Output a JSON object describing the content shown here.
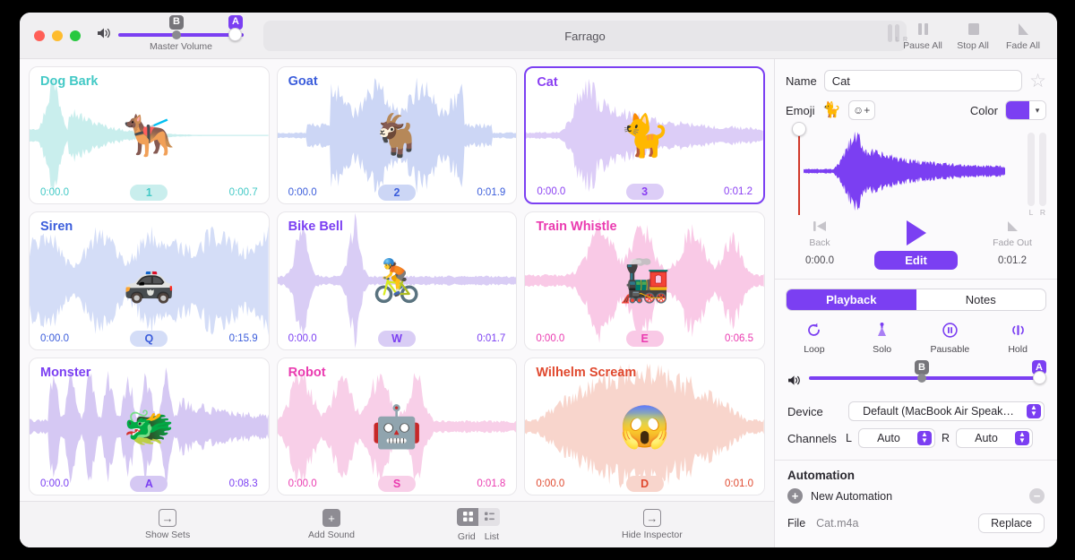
{
  "window": {
    "title": "Farrago",
    "traffic_lights": [
      "close",
      "minimize",
      "zoom"
    ]
  },
  "master_volume": {
    "label": "Master Volume",
    "badge_b": "B",
    "badge_a": "A",
    "icon": "speaker-icon"
  },
  "toolbar": {
    "buttons": [
      {
        "label": "Pause All",
        "icon": "pause-icon"
      },
      {
        "label": "Stop All",
        "icon": "stop-icon"
      },
      {
        "label": "Fade All",
        "icon": "fade-icon"
      }
    ]
  },
  "meters": {
    "left": "L",
    "right": "R"
  },
  "tiles": [
    {
      "name": "Dog Bark",
      "emoji": "🐕‍🦺",
      "hotkey": "1",
      "start": "0:00.0",
      "end": "0:00.7",
      "color": "#43c9c6",
      "wave_fill": "#c9eeed",
      "selected": false,
      "shape": "spike-left"
    },
    {
      "name": "Goat",
      "emoji": "🐐",
      "hotkey": "2",
      "start": "0:00.0",
      "end": "0:01.9",
      "color": "#3b5ddb",
      "wave_fill": "#ccd6f5",
      "selected": false,
      "shape": "dense-center"
    },
    {
      "name": "Cat",
      "emoji": "🐈",
      "hotkey": "3",
      "start": "0:00.0",
      "end": "0:01.2",
      "color": "#8a3ff2",
      "wave_fill": "#dccdf7",
      "selected": true,
      "shape": "peak-left"
    },
    {
      "name": "Siren",
      "emoji": "🚓",
      "hotkey": "Q",
      "start": "0:00.0",
      "end": "0:15.9",
      "color": "#3b5ddb",
      "wave_fill": "#d4ddf7",
      "selected": false,
      "shape": "long-noise"
    },
    {
      "name": "Bike Bell",
      "emoji": "🚴",
      "hotkey": "W",
      "start": "0:00.0",
      "end": "0:01.7",
      "color": "#7b3ff2",
      "wave_fill": "#d9cdf5",
      "selected": false,
      "shape": "two-bursts"
    },
    {
      "name": "Train Whistle",
      "emoji": "🚂",
      "hotkey": "E",
      "start": "0:00.0",
      "end": "0:06.5",
      "color": "#ea3bb0",
      "wave_fill": "#f9c9e6",
      "selected": false,
      "shape": "multi-hump"
    },
    {
      "name": "Monster",
      "emoji": "🐲",
      "hotkey": "A",
      "start": "0:00.0",
      "end": "0:08.3",
      "color": "#7b3ff2",
      "wave_fill": "#d5c8f3",
      "selected": false,
      "shape": "jagged"
    },
    {
      "name": "Robot",
      "emoji": "🤖",
      "hotkey": "S",
      "start": "0:00.0",
      "end": "0:01.8",
      "color": "#ea3bb0",
      "wave_fill": "#f8cfe8",
      "selected": false,
      "shape": "blocky"
    },
    {
      "name": "Wilhelm Scream",
      "emoji": "😱",
      "hotkey": "D",
      "start": "0:00.0",
      "end": "0:01.0",
      "color": "#e0492f",
      "wave_fill": "#f8d5cc",
      "selected": false,
      "shape": "lens"
    }
  ],
  "bottom_bar": {
    "show_sets": "Show Sets",
    "add_sound": "Add Sound",
    "grid": "Grid",
    "list": "List",
    "hide_inspector": "Hide Inspector"
  },
  "inspector": {
    "name_label": "Name",
    "name_value": "Cat",
    "name_placeholder": "Name",
    "favorite_icon": "star-icon",
    "emoji_label": "Emoji",
    "emoji_value": "🐈",
    "emoji_add": "☺+",
    "color_label": "Color",
    "color_value": "#7b3ff2",
    "transport": {
      "back_label": "Back",
      "back_time": "0:00.0",
      "fade_out_label": "Fade Out",
      "fade_out_time": "0:01.2",
      "play_icon": "play-icon",
      "edit_label": "Edit"
    },
    "tabs": [
      {
        "label": "Playback",
        "active": true
      },
      {
        "label": "Notes",
        "active": false
      }
    ],
    "modes": [
      {
        "label": "Loop",
        "icon": "loop-icon"
      },
      {
        "label": "Solo",
        "icon": "solo-icon"
      },
      {
        "label": "Pausable",
        "icon": "pause-circle-icon"
      },
      {
        "label": "Hold",
        "icon": "hold-icon"
      }
    ],
    "volume": {
      "icon": "speaker-icon",
      "badge_b": "B",
      "badge_a": "A"
    },
    "device_label": "Device",
    "device_value": "Default (MacBook Air Speak…",
    "channels_label": "Channels",
    "channel_left_label": "L",
    "channel_left_value": "Auto",
    "channel_right_label": "R",
    "channel_right_value": "Auto",
    "automation_title": "Automation",
    "new_automation": "New Automation",
    "add_icon": "plus-circle-icon",
    "remove_icon": "minus-circle-icon",
    "file_label": "File",
    "file_value": "Cat.m4a",
    "replace_label": "Replace"
  }
}
